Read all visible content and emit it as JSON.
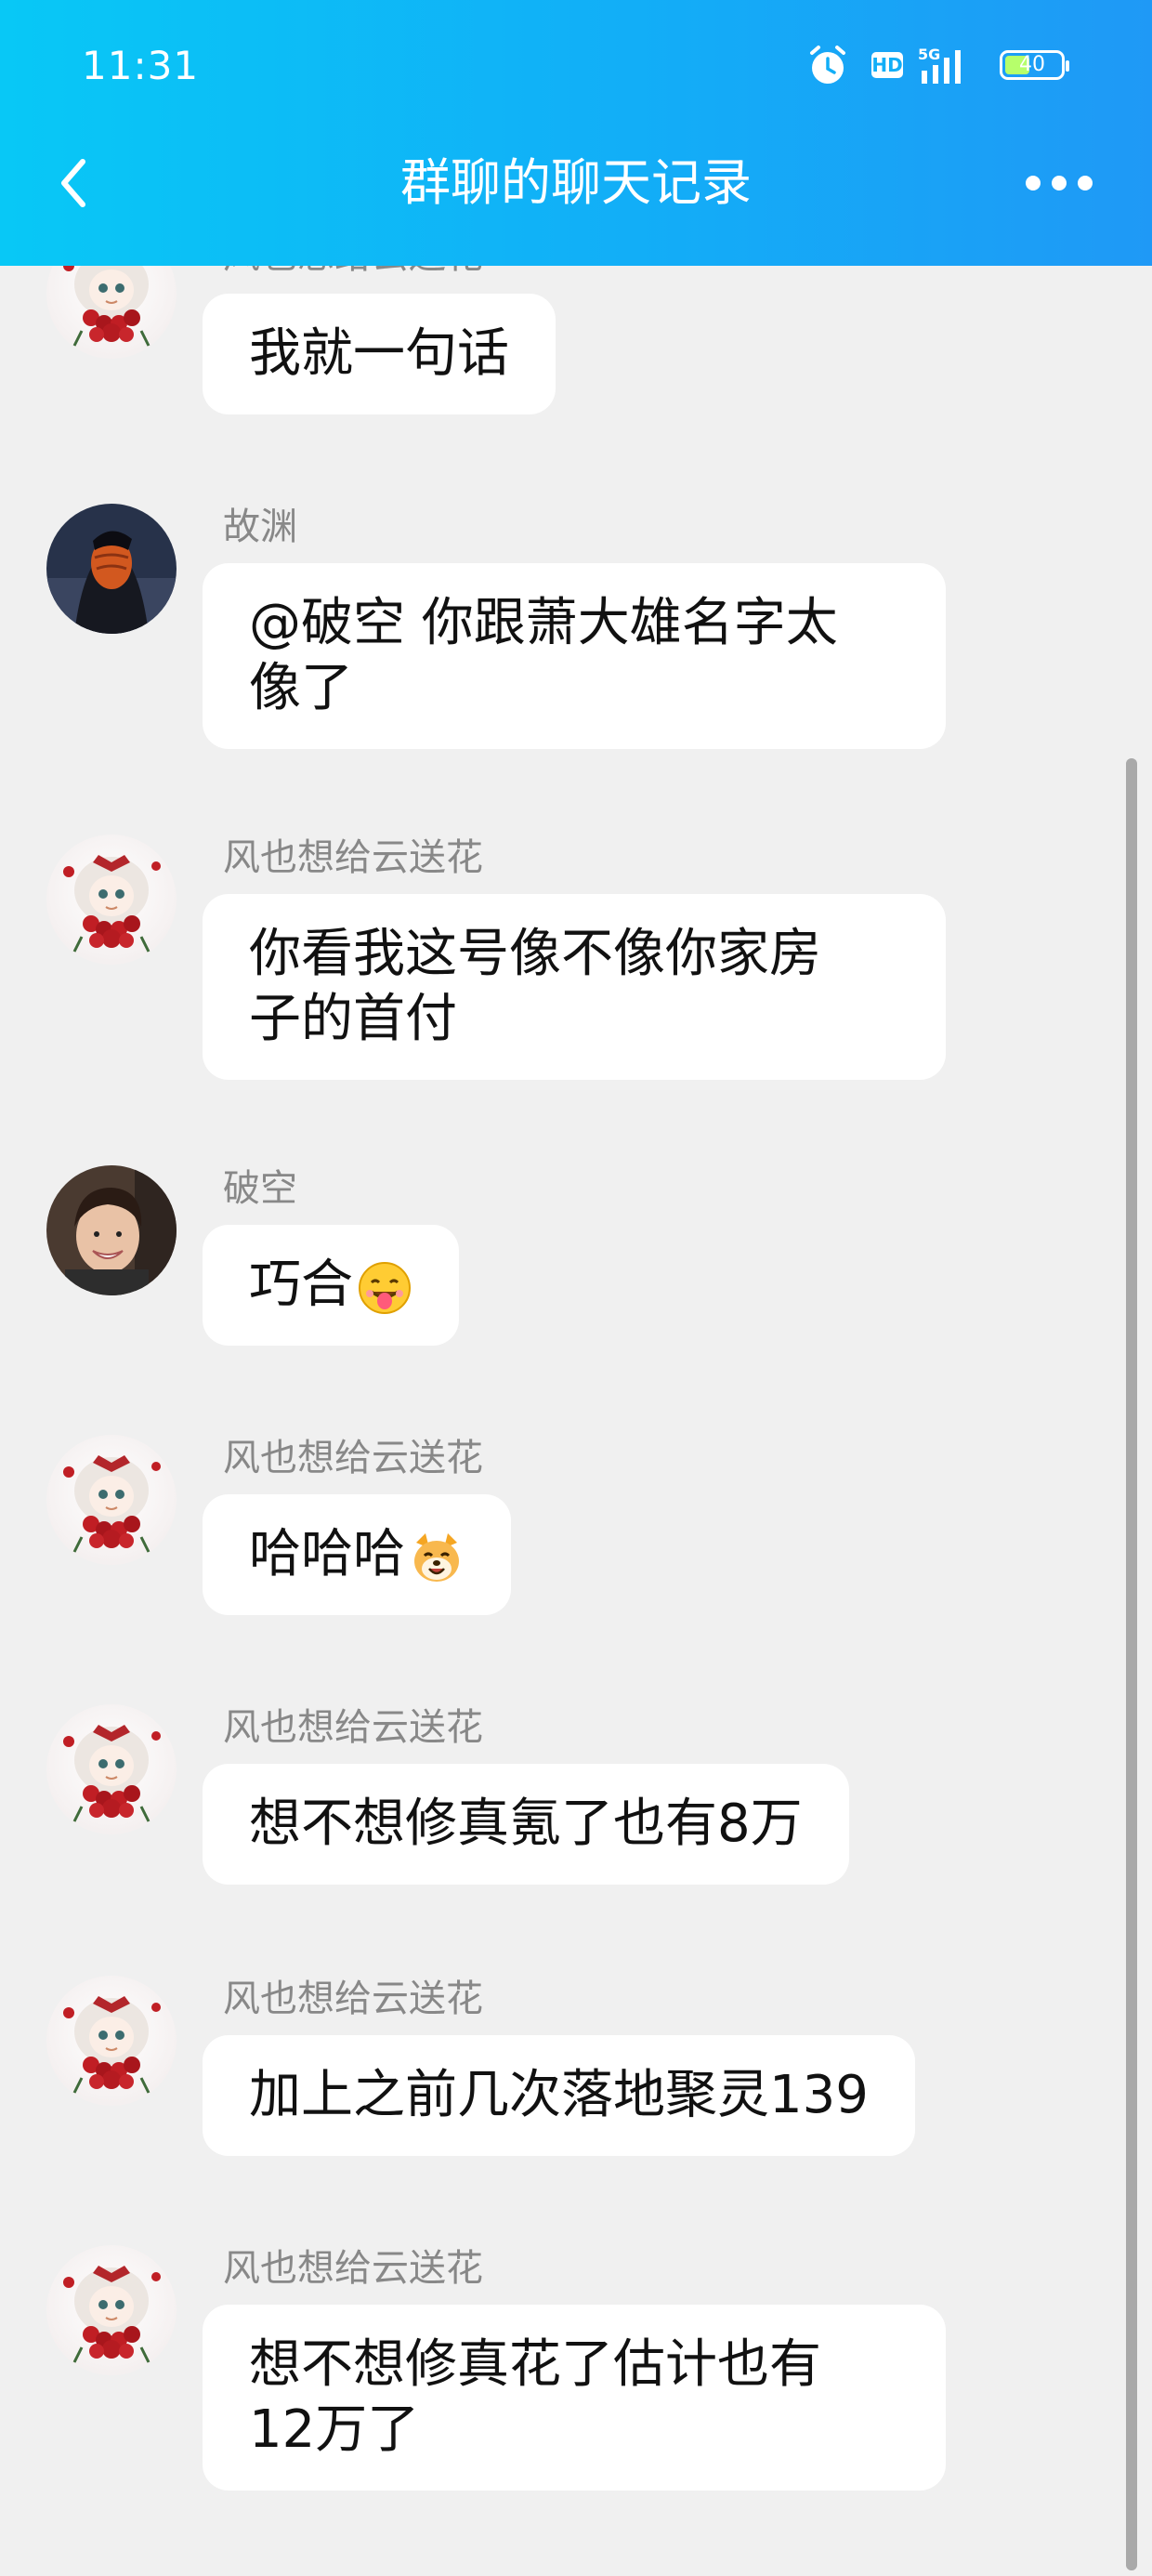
{
  "status_bar": {
    "time": "11:31",
    "hd": "HD",
    "network": "5G",
    "battery": "40"
  },
  "header": {
    "title": "群聊的聊天记录"
  },
  "icons": {
    "back": "chevron-left-icon",
    "more": "more-dots-icon",
    "alarm": "alarm-icon",
    "signal": "signal-icon",
    "battery": "battery-icon"
  },
  "colors": {
    "header_start": "#08c8f6",
    "header_end": "#1f99f6",
    "chat_bg": "#f0f0f0",
    "bubble_bg": "#ffffff"
  },
  "messages": [
    {
      "sender": "风也想给云送花",
      "text": "我就一句话",
      "avatar": "anime-girl-roses"
    },
    {
      "sender": "故渊",
      "text_lines": [
        "@破空 你跟萧大雄名字太",
        "像了"
      ],
      "avatar": "dark-cloak-mask"
    },
    {
      "sender": "风也想给云送花",
      "text_lines": [
        "你看我这号像不像你家房",
        "子的首付"
      ],
      "avatar": "anime-girl-roses"
    },
    {
      "sender": "破空",
      "text": "巧合",
      "emoji": "tongue-face-emoji",
      "avatar": "smiling-boy"
    },
    {
      "sender": "风也想给云送花",
      "text": "哈哈哈",
      "emoji": "dog-laugh-emoji",
      "avatar": "anime-girl-roses"
    },
    {
      "sender": "风也想给云送花",
      "text": "想不想修真氪了也有8万",
      "avatar": "anime-girl-roses"
    },
    {
      "sender": "风也想给云送花",
      "text": "加上之前几次落地聚灵139",
      "avatar": "anime-girl-roses"
    },
    {
      "sender": "风也想给云送花",
      "text_lines": [
        "想不想修真花了估计也有",
        "12万了"
      ],
      "avatar": "anime-girl-roses"
    }
  ]
}
